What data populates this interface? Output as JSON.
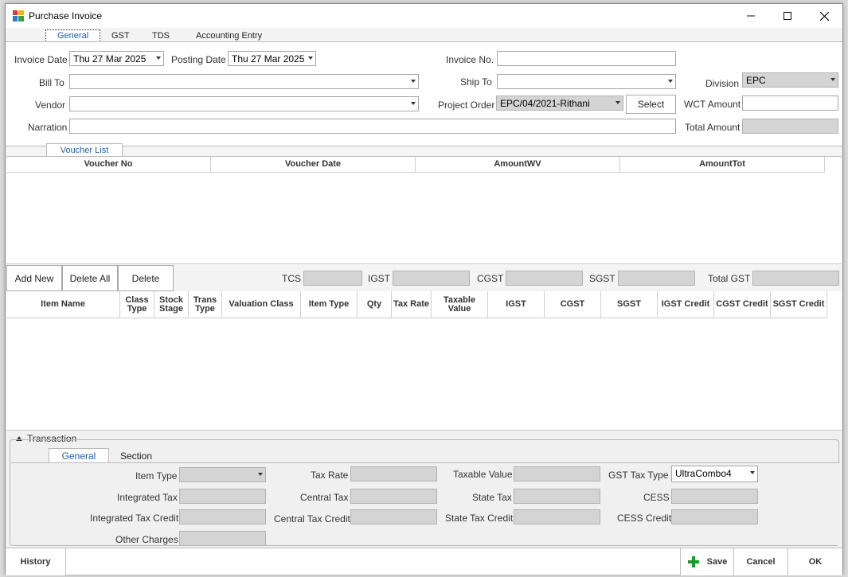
{
  "window": {
    "title": "Purchase Invoice",
    "minimize": "—",
    "maximize": "☐",
    "close": "✕"
  },
  "top_tabs": [
    "General",
    "GST",
    "TDS",
    "Accounting Entry"
  ],
  "header_form": {
    "invoice_date_label": "Invoice Date",
    "invoice_date_value": "Thu 27 Mar 2025",
    "posting_date_label": "Posting Date",
    "posting_date_value": "Thu 27 Mar 2025",
    "invoice_no_label": "Invoice No.",
    "invoice_no_value": "",
    "bill_to_label": "Bill To",
    "bill_to_value": "",
    "ship_to_label": "Ship To",
    "ship_to_value": "",
    "division_label": "Division",
    "division_value": "EPC",
    "vendor_label": "Vendor",
    "vendor_value": "",
    "project_order_label": "Project Order",
    "project_order_value": "EPC/04/2021-Rithani",
    "select_button": "Select",
    "wct_amount_label": "WCT Amount",
    "wct_amount_value": "",
    "narration_label": "Narration",
    "narration_value": "",
    "total_amount_label": "Total Amount",
    "total_amount_value": ""
  },
  "voucher_list": {
    "tab_label": "Voucher List",
    "columns": [
      "Voucher No",
      "Voucher Date",
      "AmountWV",
      "AmountTot"
    ],
    "rows": []
  },
  "action_row": {
    "add_new": "Add New",
    "delete_all": "Delete All",
    "delete": "Delete",
    "tcs_label": "TCS",
    "igst_label": "IGST",
    "cgst_label": "CGST",
    "sgst_label": "SGST",
    "total_gst_label": "Total GST"
  },
  "items_grid": {
    "columns": [
      "Item Name",
      "Class Type",
      "Stock Stage",
      "Trans Type",
      "Valuation Class",
      "Item Type",
      "Qty",
      "Tax Rate",
      "Taxable Value",
      "IGST",
      "CGST",
      "SGST",
      "IGST Credit",
      "CGST Credit",
      "SGST Credit"
    ],
    "rows": []
  },
  "transaction": {
    "group_label": "Transaction",
    "tabs": [
      "General",
      "Section"
    ],
    "item_type_label": "Item Type",
    "tax_rate_label": "Tax Rate",
    "taxable_value_label": "Taxable Value",
    "gst_tax_type_label": "GST Tax Type",
    "gst_tax_type_value": "UltraCombo4",
    "integrated_tax_label": "Integrated Tax",
    "central_tax_label": "Central Tax",
    "state_tax_label": "State Tax",
    "cess_label": "CESS",
    "integrated_tax_credit_label": "Integrated Tax Credit",
    "central_tax_credit_label": "Central Tax Credit",
    "state_tax_credit_label": "State Tax Credit",
    "cess_credit_label": "CESS Credit",
    "other_charges_label": "Other Charges"
  },
  "footer": {
    "history": "History",
    "save": "Save",
    "cancel": "Cancel",
    "ok": "OK"
  },
  "colors": {
    "accent": "#1e5fa8",
    "save_icon": "#1a9a2a"
  }
}
